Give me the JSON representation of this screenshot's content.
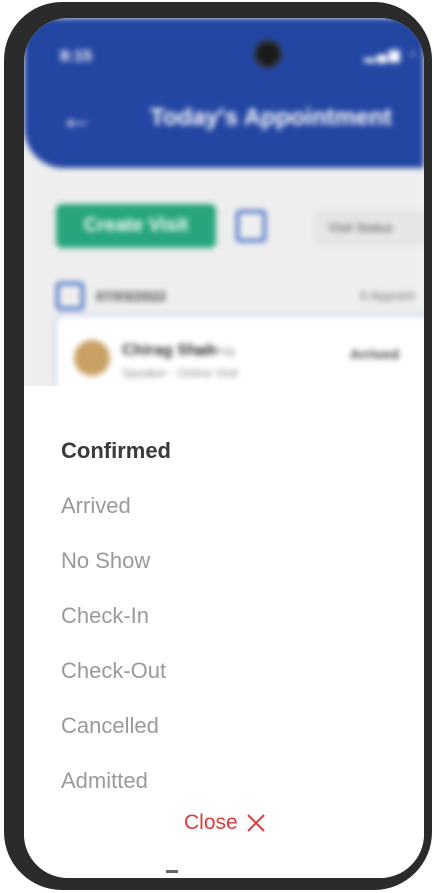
{
  "status_bar": {
    "time": "8:15",
    "icons": "▂▄▆ ◔"
  },
  "header": {
    "back_icon": "arrow-left-icon",
    "title": "Today's Appointment"
  },
  "toolbar": {
    "create_visit_label": "Create Visit",
    "visit_status_label": "Visit Status"
  },
  "date_row": {
    "date": "07/03/2022",
    "count_text": "6 Appoint"
  },
  "appointment": {
    "name": "Chirag Shah",
    "meta": "(45 Yrs)",
    "sub": "Speaker · Online Visit",
    "status": "Arrived"
  },
  "status_sheet": {
    "options": [
      {
        "label": "Confirmed",
        "selected": true
      },
      {
        "label": "Arrived",
        "selected": false
      },
      {
        "label": "No Show",
        "selected": false
      },
      {
        "label": "Check-In",
        "selected": false
      },
      {
        "label": "Check-Out",
        "selected": false
      },
      {
        "label": "Cancelled",
        "selected": false
      },
      {
        "label": "Admitted",
        "selected": false
      }
    ],
    "close_label": "Close",
    "close_icon": "close-x-icon"
  },
  "colors": {
    "header_blue": "#2346a3",
    "create_green": "#27a57d",
    "close_red": "#e03a3a",
    "option_selected": "#3a3a3a",
    "option_default": "#9a9a9a"
  }
}
